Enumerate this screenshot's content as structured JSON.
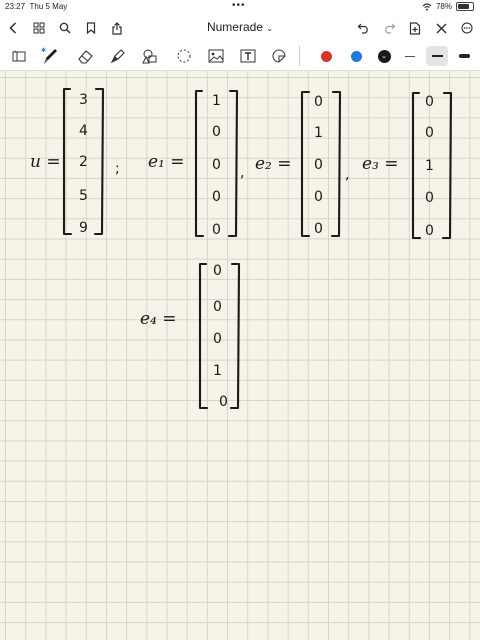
{
  "status": {
    "time": "23:27",
    "date": "Thu 5 May",
    "battery": "78%",
    "battery_level": 0.78
  },
  "nav": {
    "title": "Numerade",
    "icons": [
      "chevron-left-icon",
      "grid-icon",
      "search-icon",
      "bookmark-icon",
      "share-icon",
      "undo-icon",
      "redo-icon",
      "add-page-icon",
      "close-icon",
      "more-icon"
    ]
  },
  "toolbar": {
    "tools": [
      "page-layout-icon",
      "pen-icon",
      "eraser-icon",
      "highlighter-icon",
      "shapes-icon",
      "lasso-icon",
      "image-icon",
      "text-box-icon",
      "sticker-icon"
    ],
    "colors": {
      "red": "#d8342b",
      "blue": "#1e78e0",
      "black": "#1a1a1a",
      "accent": "#1a1a1a"
    },
    "selected_color": "black"
  },
  "notes": {
    "u_label": "u =",
    "u_values": [
      "3",
      "4",
      "2",
      "5",
      "9"
    ],
    "e1_label": "e₁ =",
    "e1_values": [
      "1",
      "0",
      "0",
      "0",
      "0"
    ],
    "e2_label": "e₂ =",
    "e2_values": [
      "0",
      "1",
      "0",
      "0",
      "0"
    ],
    "e3_label": "e₃ =",
    "e3_values": [
      "0",
      "0",
      "1",
      "0",
      "0"
    ],
    "e4_label": "e₄ =",
    "e4_values": [
      "0",
      "0",
      "0",
      "1",
      "0"
    ],
    "separator_semicolon": ";",
    "separator_comma": ","
  }
}
